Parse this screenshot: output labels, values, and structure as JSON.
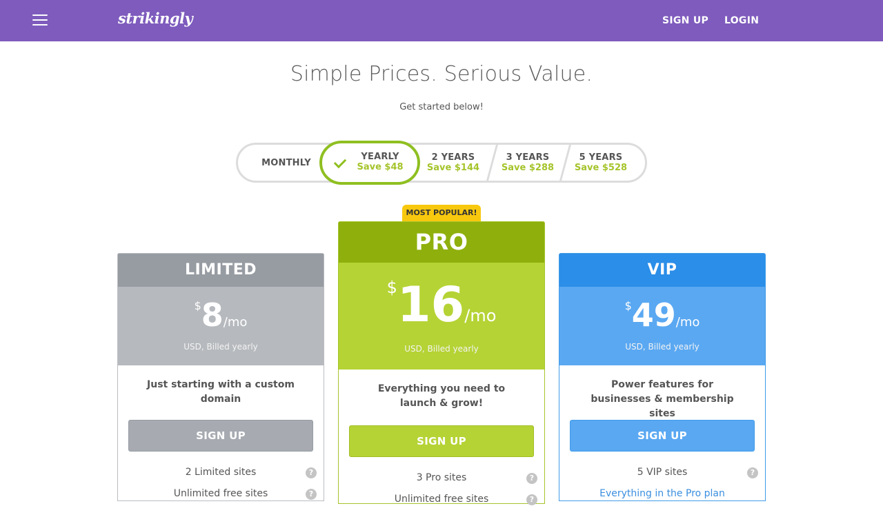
{
  "header": {
    "logo": "strikingly",
    "signup_label": "SIGN UP",
    "login_label": "LOGIN",
    "accent_color": "#7e5bbd"
  },
  "hero": {
    "title": "Simple Prices. Serious Value.",
    "subtitle": "Get started below!"
  },
  "billing": {
    "selected": "YEARLY",
    "options": [
      {
        "label": "MONTHLY",
        "save": ""
      },
      {
        "label": "YEARLY",
        "save": "Save $48"
      },
      {
        "label": "2 YEARS",
        "save": "Save $144"
      },
      {
        "label": "3 YEARS",
        "save": "Save $288"
      },
      {
        "label": "5 YEARS",
        "save": "Save $528"
      }
    ]
  },
  "badge": "MOST POPULAR!",
  "plans": [
    {
      "name": "LIMITED",
      "currency": "$",
      "amount": "8",
      "period": "/mo",
      "billing": "USD, Billed yearly",
      "description": "Just starting with a custom domain",
      "cta": "SIGN UP",
      "features": [
        "2 Limited sites",
        "Unlimited free sites"
      ],
      "color": "#979ba2"
    },
    {
      "name": "PRO",
      "currency": "$",
      "amount": "16",
      "period": "/mo",
      "billing": "USD, Billed yearly",
      "description": "Everything you need to launch & grow!",
      "cta": "SIGN UP",
      "features": [
        "3 Pro sites",
        "Unlimited free sites"
      ],
      "color": "#8fb00c"
    },
    {
      "name": "VIP",
      "currency": "$",
      "amount": "49",
      "period": "/mo",
      "billing": "USD, Billed yearly",
      "description": "Power features for businesses & membership sites",
      "cta": "SIGN UP",
      "features": [
        "5 VIP sites",
        "Everything in the Pro plan"
      ],
      "color": "#2b8ee8"
    }
  ]
}
